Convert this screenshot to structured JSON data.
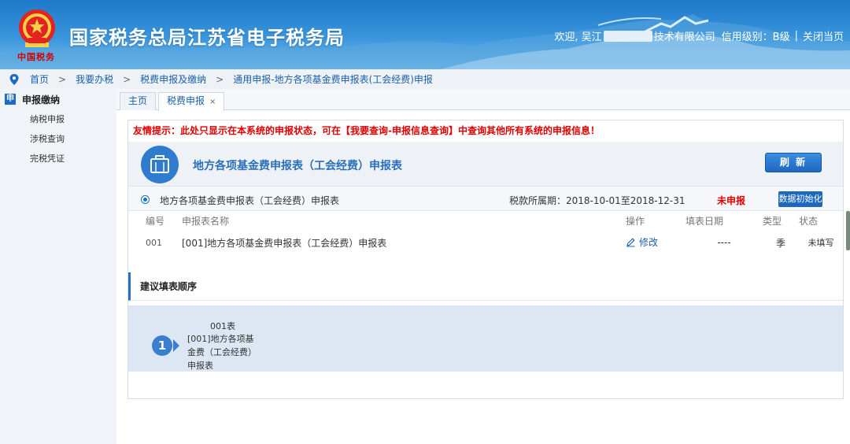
{
  "header": {
    "site_title": "国家税务总局江苏省电子税务局",
    "emblem_text": "中国税务",
    "welcome_prefix": "欢迎, 吴江",
    "welcome_suffix": "技术有限公司",
    "credit_level": "信用级别：B级",
    "separator": "|",
    "close_page": "关闭当页"
  },
  "breadcrumb": [
    "首页",
    "我要办税",
    "税费申报及缴纳",
    "通用申报-地方各项基金费申报表(工会经费)申报"
  ],
  "breadcrumb_arrow": ">",
  "sidebar": {
    "section_icon": "申",
    "section_title": "申报缴纳",
    "items": [
      "纳税申报",
      "涉税查询",
      "完税凭证"
    ]
  },
  "tabs": [
    {
      "label": "主页",
      "active": false
    },
    {
      "label": "税费申报",
      "active": true,
      "close": "×"
    }
  ],
  "notice": "友情提示：此处只显示在本系统的申报状态，可在【我要查询-申报信息查询】中查询其他所有系统的申报信息！",
  "form": {
    "title": "地方各项基金费申报表（工会经费）申报表",
    "refresh_label": "刷 新"
  },
  "selection": {
    "name": "地方各项基金费申报表（工会经费）申报表",
    "period": "税款所属期：2018-10-01至2018-12-31",
    "status": "未申报",
    "init_button": "数据初始化"
  },
  "table": {
    "headers": {
      "no": "编号",
      "name": "申报表名称",
      "op": "操作",
      "date": "填表日期",
      "type": "类型",
      "status": "状态"
    },
    "rows": [
      {
        "no": "001",
        "name": "[001]地方各项基金费申报表（工会经费）申报表",
        "op": "修改",
        "date": "----",
        "type": "季",
        "status": "未填写"
      }
    ]
  },
  "suggest": {
    "title": "建议填表顺序",
    "steps": [
      {
        "num": "1",
        "code": "001表",
        "name": "[001]地方各项基金费（工会经费）申报表"
      }
    ]
  },
  "colors": {
    "accent": "#1a6cc4",
    "danger": "#e00000",
    "warning": "#e08a00",
    "step_bg": "#dce7f3"
  }
}
